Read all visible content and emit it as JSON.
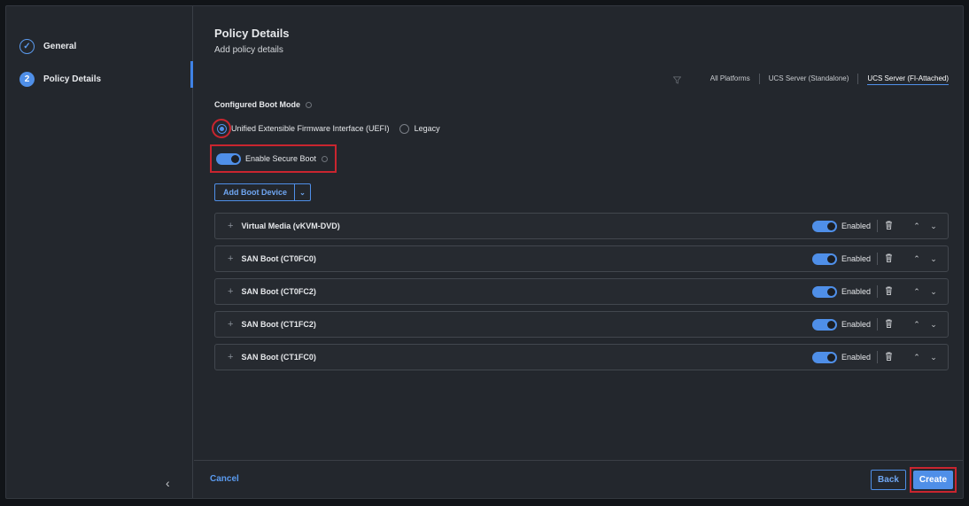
{
  "steps": [
    {
      "number": "✓",
      "label": "General",
      "state": "done"
    },
    {
      "number": "2",
      "label": "Policy Details",
      "state": "active"
    }
  ],
  "header": {
    "title": "Policy Details",
    "subtitle": "Add policy details"
  },
  "platforms": [
    "All Platforms",
    "UCS Server (Standalone)",
    "UCS Server (FI-Attached)"
  ],
  "selected_platform": "UCS Server (FI-Attached)",
  "boot_mode": {
    "label": "Configured Boot Mode",
    "options": [
      "Unified Extensible Firmware Interface (UEFI)",
      "Legacy"
    ],
    "selected": "Unified Extensible Firmware Interface (UEFI)"
  },
  "secure_boot": {
    "label": "Enable Secure Boot",
    "enabled": true
  },
  "add_boot_device": {
    "label": "Add Boot Device"
  },
  "boot_devices": [
    {
      "name": "Virtual Media (vKVM-DVD)",
      "status": "Enabled"
    },
    {
      "name": "SAN Boot (CT0FC0)",
      "status": "Enabled"
    },
    {
      "name": "SAN Boot (CT0FC2)",
      "status": "Enabled"
    },
    {
      "name": "SAN Boot (CT1FC2)",
      "status": "Enabled"
    },
    {
      "name": "SAN Boot (CT1FC0)",
      "status": "Enabled"
    }
  ],
  "footer": {
    "cancel": "Cancel",
    "back": "Back",
    "create": "Create"
  },
  "colors": {
    "accent": "#4f8fe8",
    "highlight": "#c9252f",
    "background": "#23272d"
  },
  "icons": {
    "filter": "filter-icon",
    "trash": "trash-icon",
    "collapse": "chevron-left-icon"
  }
}
